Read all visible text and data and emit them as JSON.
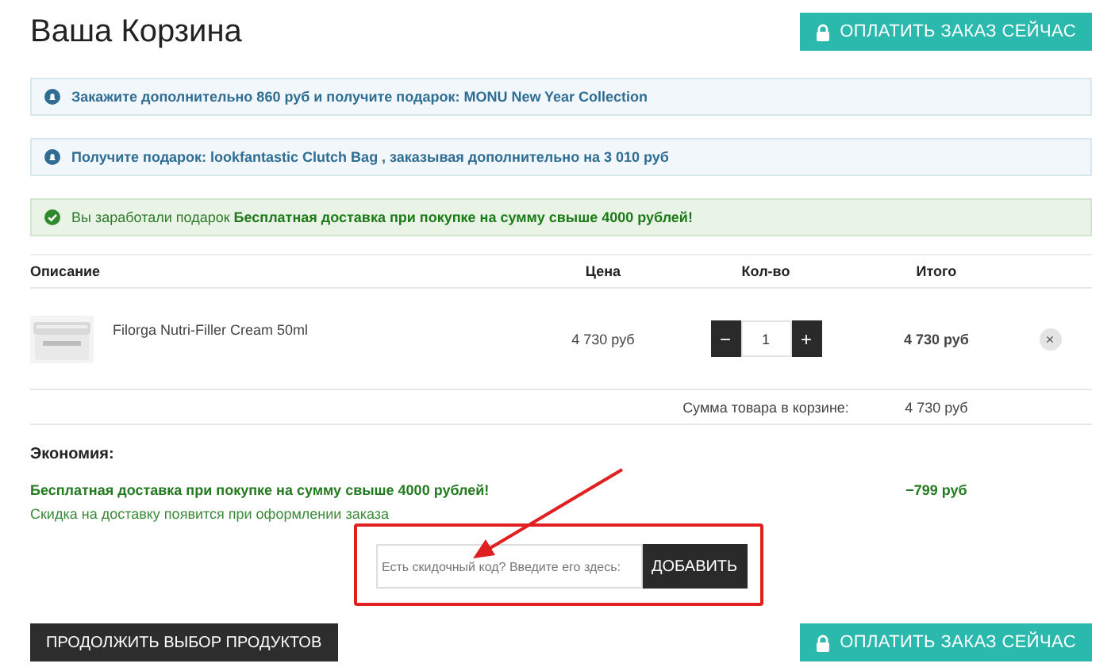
{
  "title": "Ваша Корзина",
  "pay_button": {
    "label": "ОПЛАТИТЬ ЗАКАЗ СЕЙЧАС"
  },
  "notices": [
    {
      "kind": "info",
      "text": "Закажите дополнительно 860 руб и получите подарок: MONU New Year Collection"
    },
    {
      "kind": "info",
      "text": "Получите подарок: lookfantastic Clutch Bag , заказывая дополнительно на 3 010 руб"
    },
    {
      "kind": "success",
      "text": "Вы заработали подарок **Бесплатная доставка при покупке на сумму свыше 4000 рублей!**"
    }
  ],
  "table": {
    "columns": [
      "Описание",
      "Цена",
      "Кол-во",
      "Итого"
    ],
    "rows": [
      {
        "name": "Filorga Nutri-Filler Cream 50ml",
        "price": "4 730 руб",
        "quantity": "1",
        "decrement": "−",
        "increment": "+",
        "total": "4 730 руб",
        "remove": "×"
      }
    ],
    "subtotal": {
      "label": "Сумма товара в корзине:",
      "value": "4 730 руб"
    }
  },
  "savings": {
    "title": "Экономия:",
    "items": [
      {
        "label": "Бесплатная доставка при покупке на сумму свыше 4000 рублей!",
        "value": "−799 руб",
        "note": "Скидка на доставку появится при оформлении заказа"
      }
    ]
  },
  "coupon": {
    "placeholder": "Есть скидочный код? Введите его здесь:",
    "button": "ДОБАВИТЬ"
  },
  "continue_button": {
    "label": "ПРОДОЛЖИТЬ ВЫБОР ПРОДУКТОВ"
  },
  "pay_button_bottom": {
    "label": "ОПЛАТИТЬ ЗАКАЗ СЕЙЧАС"
  }
}
